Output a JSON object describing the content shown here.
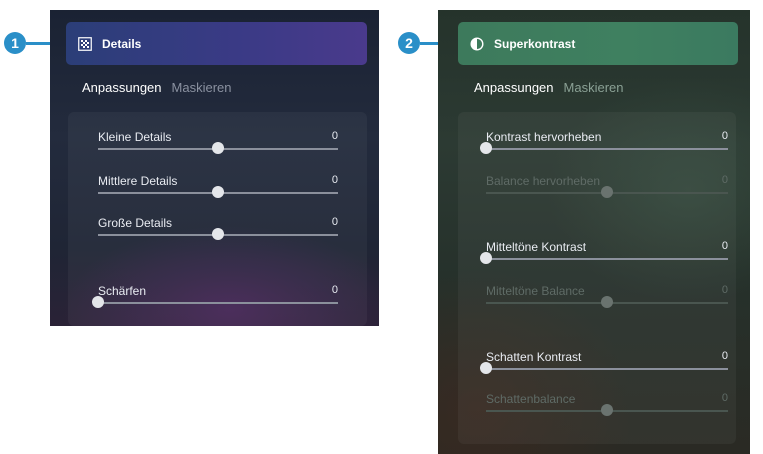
{
  "callouts": [
    "1",
    "2"
  ],
  "panel1": {
    "title": "Details",
    "icon": "details-grid-icon",
    "header_color": "#3b3a86",
    "tabs": {
      "active": "Anpassungen",
      "inactive": "Maskieren"
    },
    "sliders": [
      {
        "label": "Kleine Details",
        "value": "0",
        "level": 0.5,
        "dimmed": false
      },
      {
        "label": "Mittlere Details",
        "value": "0",
        "level": 0.5,
        "dimmed": false
      },
      {
        "label": "Große Details",
        "value": "0",
        "level": 0.5,
        "dimmed": false
      },
      {
        "label": "Schärfen",
        "value": "0",
        "level": 0.0,
        "dimmed": false
      }
    ]
  },
  "panel2": {
    "title": "Superkontrast",
    "icon": "contrast-half-circle-icon",
    "header_color": "#3f8060",
    "tabs": {
      "active": "Anpassungen",
      "inactive": "Maskieren"
    },
    "sliders": [
      {
        "label": "Kontrast hervorheben",
        "value": "0",
        "level": 0.0,
        "dimmed": false
      },
      {
        "label": "Balance hervorheben",
        "value": "0",
        "level": 0.5,
        "dimmed": true
      },
      {
        "label": "Mitteltöne Kontrast",
        "value": "0",
        "level": 0.0,
        "dimmed": false
      },
      {
        "label": "Mitteltöne Balance",
        "value": "0",
        "level": 0.5,
        "dimmed": true
      },
      {
        "label": "Schatten Kontrast",
        "value": "0",
        "level": 0.0,
        "dimmed": false
      },
      {
        "label": "Schattenbalance",
        "value": "0",
        "level": 0.5,
        "dimmed": true
      }
    ]
  },
  "accent_color": "#2a8fc8"
}
